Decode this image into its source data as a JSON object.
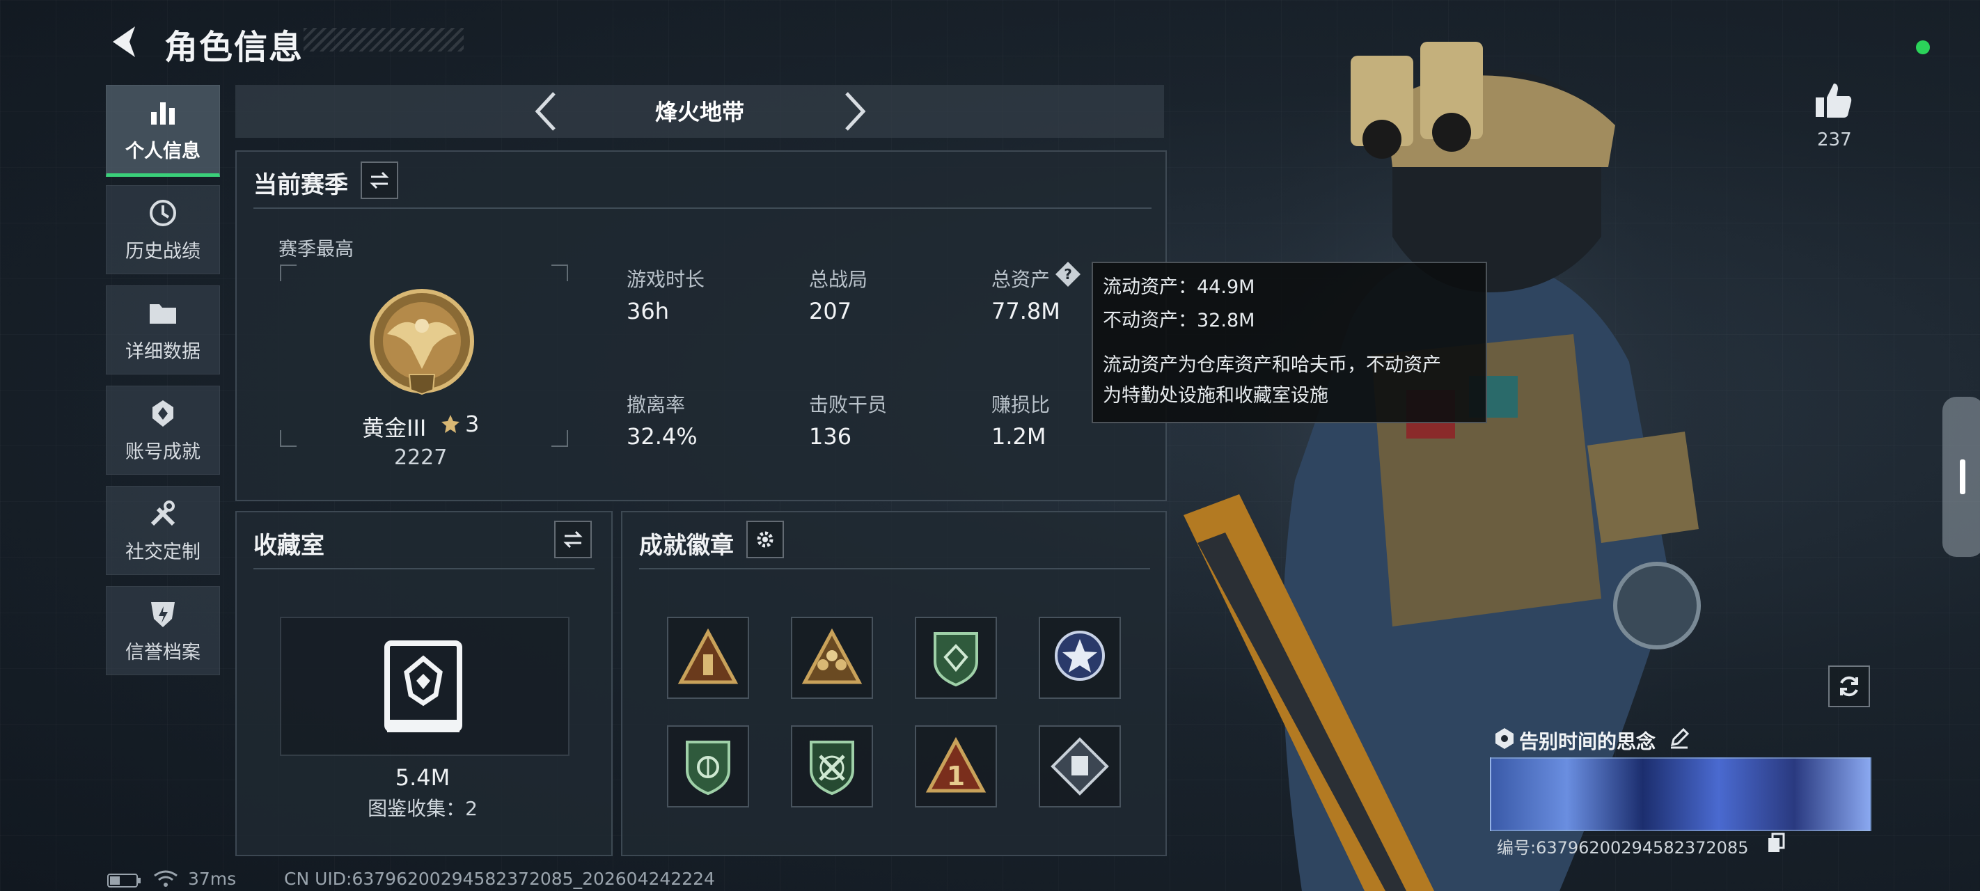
{
  "header": {
    "title": "角色信息"
  },
  "sidebar": {
    "items": [
      {
        "label": "个人信息",
        "icon": "bar-chart-icon",
        "active": true
      },
      {
        "label": "历史战绩",
        "icon": "history-icon"
      },
      {
        "label": "详细数据",
        "icon": "folder-icon"
      },
      {
        "label": "账号成就",
        "icon": "achievement-icon"
      },
      {
        "label": "社交定制",
        "icon": "tools-icon"
      },
      {
        "label": "信誉档案",
        "icon": "shield-icon"
      }
    ]
  },
  "mode_selector": {
    "label": "烽火地带"
  },
  "season": {
    "title": "当前赛季",
    "highest_label": "赛季最高",
    "rank_name": "黄金III",
    "rank_stars": "3",
    "rank_score": "2227",
    "stats": [
      {
        "label": "游戏时长",
        "value": "36h"
      },
      {
        "label": "总战局",
        "value": "207"
      },
      {
        "label": "总资产",
        "value": "77.8M"
      },
      {
        "label": "撤离率",
        "value": "32.4%"
      },
      {
        "label": "击败干员",
        "value": "136"
      },
      {
        "label": "赚损比",
        "value": "1.2M"
      }
    ]
  },
  "tooltip": {
    "liquid": "流动资产：44.9M",
    "fixed": "不动资产：32.8M",
    "desc_line1": "流动资产为仓库资产和哈夫币，不动资产",
    "desc_line2": "为特勤处设施和收藏室设施"
  },
  "collection": {
    "title": "收藏室",
    "value": "5.4M",
    "count_label": "图鉴收集：2"
  },
  "badges": {
    "title": "成就徽章",
    "items": [
      {
        "icon": "triangle-ammo-badge-icon"
      },
      {
        "icon": "triangle-squad-badge-icon"
      },
      {
        "icon": "green-shield-badge-icon"
      },
      {
        "icon": "star-emblem-badge-icon"
      },
      {
        "icon": "green-shield-wings-badge-icon"
      },
      {
        "icon": "green-shield-cross-badge-icon"
      },
      {
        "icon": "triangle-number-one-badge-icon"
      },
      {
        "icon": "diamond-cube-badge-icon"
      }
    ]
  },
  "profile": {
    "likes": "237",
    "card_title": "告别时间的思念",
    "id_label": "编号:637962002945823720​85"
  },
  "footer": {
    "ping": "37ms",
    "uid": "CN UID:637962002945823720​85_202604242224"
  },
  "colors": {
    "accent": "#3ad07a",
    "status_dot": "#2bd35a",
    "gold": "#c9a25a"
  }
}
